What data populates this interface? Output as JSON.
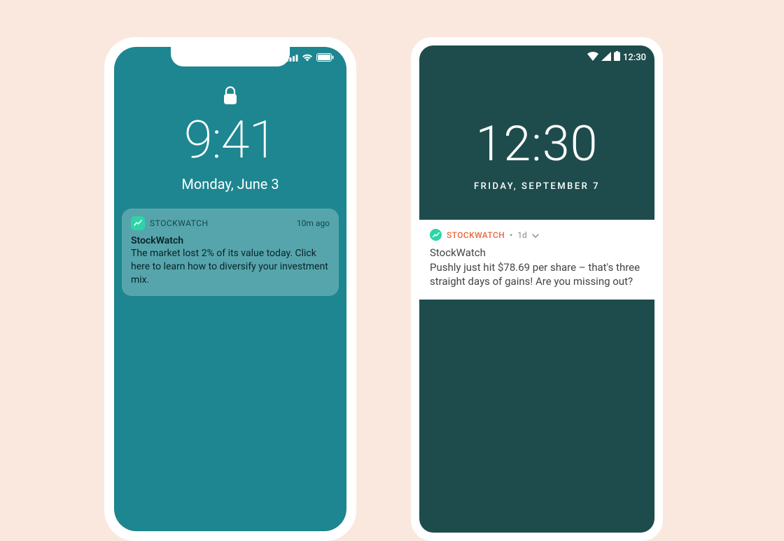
{
  "ios": {
    "time": "9:41",
    "date": "Monday, June 3",
    "notification": {
      "app_name": "STOCKWATCH",
      "age": "10m ago",
      "title": "StockWatch",
      "body": "The market lost 2% of its value today. Click here to learn how to diversify your investment mix."
    }
  },
  "android": {
    "status_time": "12:30",
    "time": "12:30",
    "date": "FRIDAY, SEPTEMBER 7",
    "notification": {
      "app_name": "STOCKWATCH",
      "separator": "•",
      "age": "1d",
      "title": "StockWatch",
      "body": "Pushly just hit $78.69 per share – that's three straight days of gains! Are you missing out?"
    }
  }
}
